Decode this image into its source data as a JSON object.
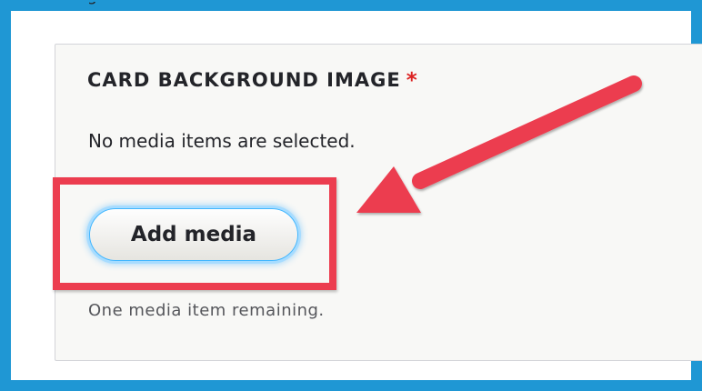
{
  "field": {
    "clipped_text": "g",
    "legend": "CARD BACKGROUND IMAGE",
    "required_marker": "*",
    "empty_message": "No media items are selected.",
    "add_media_label": "Add media",
    "remaining_message": "One media item remaining."
  },
  "annotation": {
    "frame_color": "#1f97d4",
    "highlight_color": "#ec3d4f",
    "arrow_color": "#ec3d4f"
  },
  "colors": {
    "required": "#dc2323",
    "focus_ring": "#40b6ff",
    "fieldset_bg": "#f8f8f6"
  }
}
